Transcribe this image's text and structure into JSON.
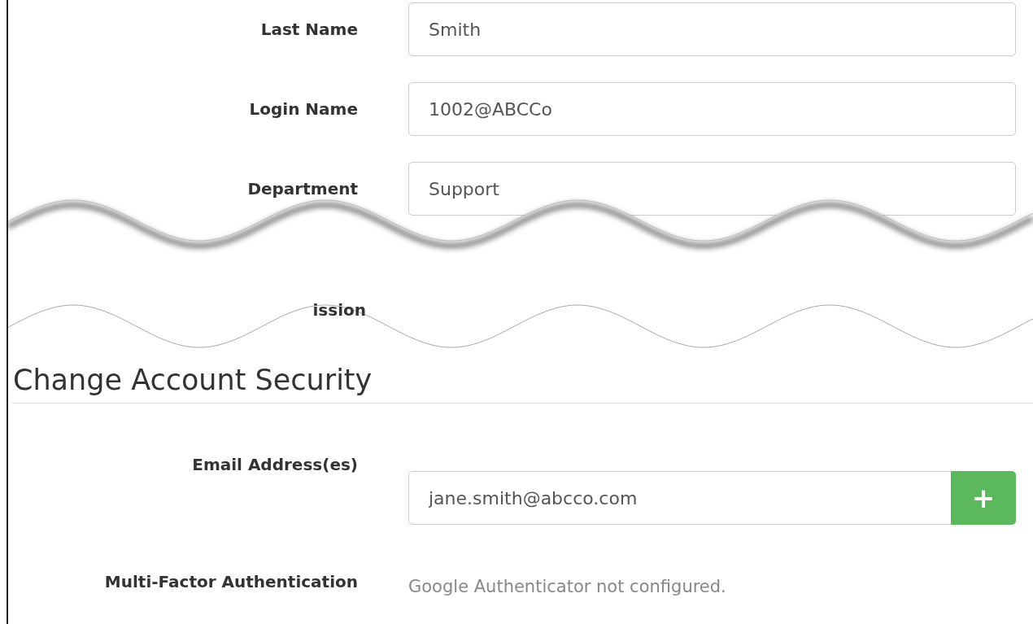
{
  "fields": [
    {
      "label": "Last Name",
      "value": "Smith"
    },
    {
      "label": "Login Name",
      "value": "1002@ABCCo"
    },
    {
      "label": "Department",
      "value": "Support"
    }
  ],
  "cut_label": "ission",
  "security": {
    "title": "Change Account Security",
    "email": {
      "label": "Email Address(es)",
      "value": "jane.smith@abcco.com",
      "add_button": "+"
    },
    "mfa": {
      "label": "Multi-Factor Authentication",
      "status": "Google Authenticator not configured."
    }
  }
}
